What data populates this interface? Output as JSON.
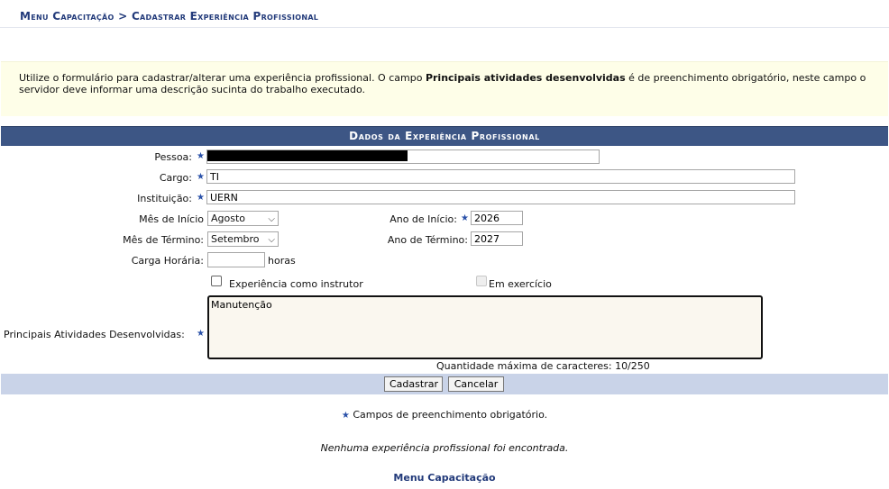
{
  "breadcrumb": "Menu Capacitação > Cadastrar Experiência Profissional",
  "info": {
    "text_before": "Utilize o formulário para cadastrar/alterar uma experiência profissional. O campo ",
    "text_bold": "Principais atividades desenvolvidas",
    "text_after": " é de preenchimento obrigatório, neste campo o servidor deve informar uma descrição sucinta do trabalho executado."
  },
  "form": {
    "header": "Dados da Experiência Profissional",
    "pessoa_label": "Pessoa:",
    "pessoa_value": "",
    "cargo_label": "Cargo:",
    "cargo_value": "TI",
    "instituicao_label": "Instituição:",
    "instituicao_value": "UERN",
    "mes_inicio_label": "Mês de Início",
    "mes_inicio_value": "Agosto",
    "ano_inicio_label": "Ano de Início:",
    "ano_inicio_value": "2026",
    "mes_termino_label": "Mês de Término:",
    "mes_termino_value": "Setembro",
    "ano_termino_label": "Ano de Término:",
    "ano_termino_value": "2027",
    "carga_label": "Carga Horária:",
    "carga_value": "",
    "carga_unit": "horas",
    "instrutor_label": "Experiência como instrutor",
    "exercicio_label": "Em exercício",
    "atividades_label": "Principais Atividades Desenvolvidas:",
    "atividades_value": "Manutenção",
    "char_count": "Quantidade máxima de caracteres: 10/250",
    "star": "★"
  },
  "buttons": {
    "cadastrar": "Cadastrar",
    "cancelar": "Cancelar"
  },
  "footer": {
    "required_note": "Campos de preenchimento obrigatório.",
    "empty_message": "Nenhuma experiência profissional foi encontrada.",
    "menu_link": "Menu Capacitação"
  },
  "colors": {
    "header_bg": "#3d5685",
    "info_bg": "#fefee8",
    "button_bar_bg": "#c9d3e8",
    "link": "#223a7a"
  }
}
